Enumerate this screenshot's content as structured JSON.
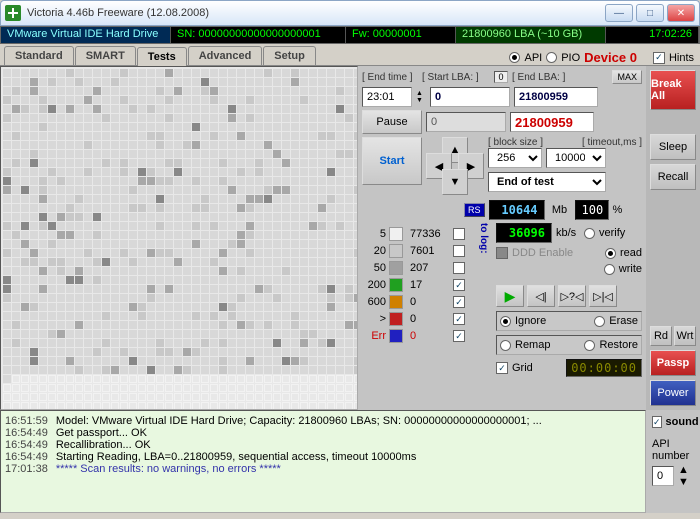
{
  "window": {
    "title": "Victoria 4.46b Freeware (12.08.2008)"
  },
  "infobar": {
    "drive": "VMware Virtual IDE Hard Drive",
    "sn": "SN: 00000000000000000001",
    "fw": "Fw: 00000001",
    "lba": "21800960 LBA (~10 GB)",
    "time": "17:02:26"
  },
  "tabs": [
    "Standard",
    "SMART",
    "Tests",
    "Advanced",
    "Setup"
  ],
  "tab_right": {
    "api": "API",
    "pio": "PIO",
    "device": "Device 0",
    "hints": "Hints"
  },
  "scan": {
    "end_time_lbl": "[ End time ]",
    "end_time": "23:01",
    "start_lba_lbl": "[ Start LBA: ]",
    "start_lba": "0",
    "start_off": "0",
    "end_lba_lbl": "[ End LBA: ]",
    "end_lba": "21800959",
    "max": "MAX",
    "cur_start": "0",
    "cur_end": "21800959",
    "pause": "Pause",
    "start": "Start",
    "block_lbl": "[ block size ]",
    "block": "256",
    "timeout_lbl": "[ timeout,ms ]",
    "timeout": "10000",
    "mode": "End of test",
    "rs": "RS",
    "to_log": "to log:",
    "speed_mb": "10644",
    "speed_mb_u": "Mb",
    "pct": "100",
    "pct_u": "%",
    "speed_kb": "36096",
    "speed_kb_u": "kb/s",
    "ddd": "DDD Enable",
    "verify": "verify",
    "read": "read",
    "write": "write",
    "ignore": "Ignore",
    "erase": "Erase",
    "remap": "Remap",
    "restore": "Restore",
    "grid": "Grid",
    "timer": "00:00:00"
  },
  "stats": {
    "r5": {
      "lbl": "5",
      "val": "77336",
      "c": "#f0f0f0"
    },
    "r20": {
      "lbl": "20",
      "val": "7601",
      "c": "#c8c8c8"
    },
    "r50": {
      "lbl": "50",
      "val": "207",
      "c": "#a0a0a0"
    },
    "r200": {
      "lbl": "200",
      "val": "17",
      "c": "#20a020"
    },
    "r600": {
      "lbl": "600",
      "val": "0",
      "c": "#d08000"
    },
    "rslow": {
      "lbl": ">",
      "val": "0",
      "c": "#c02020"
    },
    "rerr": {
      "lbl": "Err",
      "val": "0",
      "c": "#2020c0"
    }
  },
  "side": {
    "break": "Break All",
    "sleep": "Sleep",
    "recall": "Recall",
    "rd": "Rd",
    "wrt": "Wrt",
    "passp": "Passp",
    "power": "Power",
    "sound": "sound",
    "api_num": "API number",
    "api_val": "0"
  },
  "log": [
    {
      "ts": "16:51:59",
      "msg": "Model: VMware Virtual IDE Hard Drive; Capacity: 21800960 LBAs; SN: 00000000000000000001; ...",
      "cls": ""
    },
    {
      "ts": "16:54:49",
      "msg": "Get passport... OK",
      "cls": ""
    },
    {
      "ts": "16:54:49",
      "msg": "Recallibration... OK",
      "cls": ""
    },
    {
      "ts": "16:54:49",
      "msg": "Starting Reading, LBA=0..21800959, sequential access, timeout 10000ms",
      "cls": ""
    },
    {
      "ts": "17:01:38",
      "msg": "***** Scan results: no warnings, no errors *****",
      "cls": "result"
    }
  ]
}
